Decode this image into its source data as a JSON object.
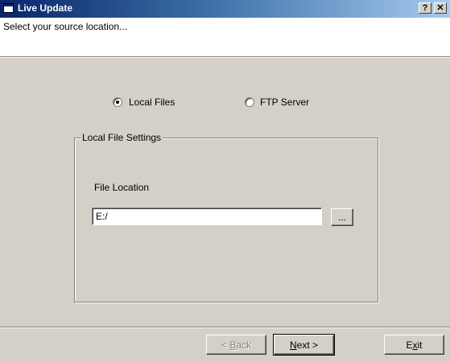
{
  "window": {
    "title": "Live Update",
    "help_button": "?",
    "close_button": "✕"
  },
  "header": {
    "instruction": "Select your source location..."
  },
  "source": {
    "options": [
      {
        "label": "Local Files",
        "selected": true
      },
      {
        "label": "FTP Server",
        "selected": false
      }
    ]
  },
  "local_settings": {
    "group_title": "Local File Settings",
    "file_location_label": "File Location",
    "file_location_value": "E:/",
    "browse_label": "..."
  },
  "buttons": {
    "back_pre": "< ",
    "back_u": "B",
    "back_post": "ack",
    "next_u": "N",
    "next_post": "ext >",
    "exit_pre": "E",
    "exit_u": "x",
    "exit_post": "it"
  }
}
